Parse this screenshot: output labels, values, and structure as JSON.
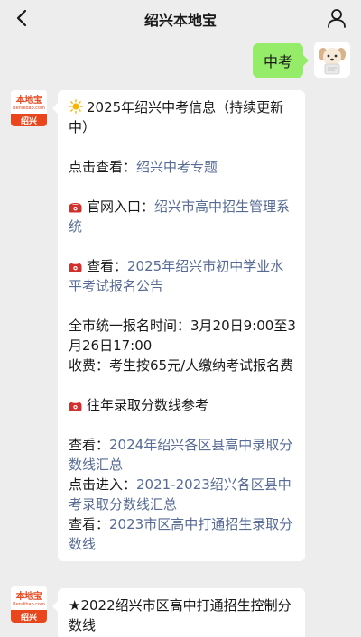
{
  "nav": {
    "title": "绍兴本地宝"
  },
  "user_message": {
    "text": "中考"
  },
  "bot_avatar": {
    "brand": "本地宝",
    "domain": "Bendibao.com",
    "city": "绍兴"
  },
  "reply1": {
    "headline": "2025年绍兴中考信息（持续更新中）",
    "topic_prefix": "点击查看：",
    "topic_link": "绍兴中考专题",
    "official_prefix": "官网入口：",
    "official_link": "绍兴市高中招生管理系统",
    "notice_prefix": "查看：",
    "notice_link": "2025年绍兴市初中学业水平考试报名公告",
    "reg_time_line": "全市统一报名时间：3月20日9:00至3月26日17:00",
    "fee_line": "收费：考生按65元/人缴纳考试报名费",
    "history_title": "往年录取分数线参考",
    "hist1_prefix": "查看：",
    "hist1_link": "2024年绍兴各区县高中录取分数线汇总",
    "hist2_prefix": "点击进入：",
    "hist2_link": "2021-2023绍兴各区县中考录取分数线汇总",
    "hist3_prefix": "查看：",
    "hist3_link": "2023市区高中打通招生录取分数线"
  },
  "reply2": {
    "text": "★2022绍兴市区高中打通招生控制分数线"
  },
  "colors": {
    "background": "#ededed",
    "user_bubble": "#95ec69",
    "bot_bubble": "#ffffff",
    "link": "#576b95",
    "brand": "#e8471d"
  }
}
